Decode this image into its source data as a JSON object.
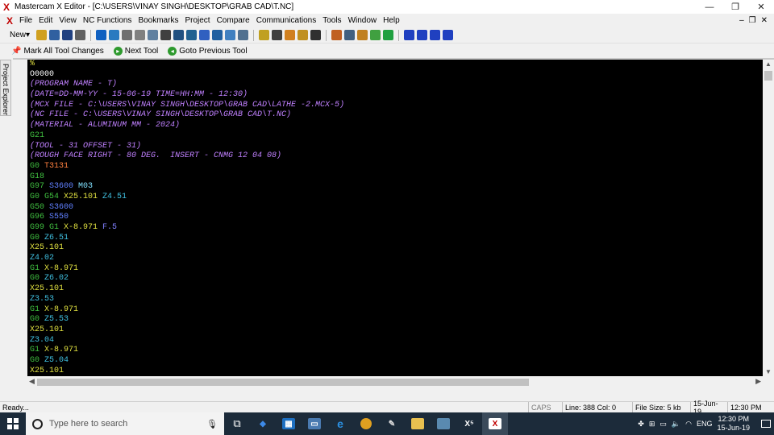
{
  "window": {
    "title": "Mastercam X Editor - [C:\\USERS\\VINAY SINGH\\DESKTOP\\GRAB CAD\\T.NC]",
    "app_icon": "X",
    "minimize": "—",
    "restore": "❐",
    "close": "✕"
  },
  "menu": {
    "doc_icon": "X",
    "items": [
      "File",
      "Edit",
      "View",
      "NC Functions",
      "Bookmarks",
      "Project",
      "Compare",
      "Communications",
      "Tools",
      "Window",
      "Help"
    ],
    "mdi_minimize": "–",
    "mdi_restore": "❐",
    "mdi_close": "✕"
  },
  "toolbar": {
    "new_label": "New",
    "icon_colors": [
      "#d0a020",
      "#3060a0",
      "#204080",
      "#606060",
      "#1060c0",
      "#2a7ac0",
      "#707070",
      "#808080",
      "#6080a0",
      "#404040",
      "#205080",
      "#206090",
      "#3060c0",
      "#2060a0",
      "#4080c0",
      "#507090",
      "#c0a020",
      "#404040",
      "#d08020",
      "#c09020",
      "#303030",
      "#c06020",
      "#406080",
      "#c08020",
      "#40a040",
      "#20a040",
      "#2040c0",
      "#2040c0",
      "#2040c0",
      "#2040c0"
    ]
  },
  "toolbar2": {
    "mark_all": "Mark All Tool Changes",
    "next_tool": "Next Tool",
    "goto_previous": "Goto Previous Tool"
  },
  "side_panel": {
    "label": "Project Explorer"
  },
  "colors": {
    "comment": "#c080ff",
    "g_code": "#40c040",
    "x_word": "#e0e040",
    "z_word": "#40c0e0",
    "s_word": "#6080ff",
    "t_word": "#ff8040",
    "m_word": "#80e0ff",
    "f_word": "#8080ff",
    "plain": "#ffffff",
    "percent": "#e0e040"
  },
  "editor": {
    "lines": [
      [
        {
          "t": "%",
          "c": "percent"
        }
      ],
      [
        {
          "t": "O0000",
          "c": "plain"
        }
      ],
      [
        {
          "t": "(PROGRAM NAME - T)",
          "c": "comment"
        }
      ],
      [
        {
          "t": "(DATE=DD-MM-YY - 15-06-19 TIME=HH:MM - 12:30)",
          "c": "comment"
        }
      ],
      [
        {
          "t": "(MCX FILE - C:\\USERS\\VINAY SINGH\\DESKTOP\\GRAB CAD\\LATHE -2.MCX-5)",
          "c": "comment"
        }
      ],
      [
        {
          "t": "(NC FILE - C:\\USERS\\VINAY SINGH\\DESKTOP\\GRAB CAD\\T.NC)",
          "c": "comment"
        }
      ],
      [
        {
          "t": "(MATERIAL - ALUMINUM MM - 2024)",
          "c": "comment"
        }
      ],
      [
        {
          "t": "G21",
          "c": "g_code"
        }
      ],
      [
        {
          "t": "(TOOL - 31 OFFSET - 31)",
          "c": "comment"
        }
      ],
      [
        {
          "t": "(ROUGH FACE RIGHT - 80 DEG.  INSERT - CNMG 12 04 08)",
          "c": "comment"
        }
      ],
      [
        {
          "t": "G0 ",
          "c": "g_code"
        },
        {
          "t": "T3131",
          "c": "t_word"
        }
      ],
      [
        {
          "t": "G18",
          "c": "g_code"
        }
      ],
      [
        {
          "t": "G97 ",
          "c": "g_code"
        },
        {
          "t": "S3600 ",
          "c": "s_word"
        },
        {
          "t": "M03",
          "c": "m_word"
        }
      ],
      [
        {
          "t": "G0 G54 ",
          "c": "g_code"
        },
        {
          "t": "X25.101 ",
          "c": "x_word"
        },
        {
          "t": "Z4.51",
          "c": "z_word"
        }
      ],
      [
        {
          "t": "G50 ",
          "c": "g_code"
        },
        {
          "t": "S3600",
          "c": "s_word"
        }
      ],
      [
        {
          "t": "G96 ",
          "c": "g_code"
        },
        {
          "t": "S550",
          "c": "s_word"
        }
      ],
      [
        {
          "t": "G99 G1 ",
          "c": "g_code"
        },
        {
          "t": "X-8.971 ",
          "c": "x_word"
        },
        {
          "t": "F.5",
          "c": "f_word"
        }
      ],
      [
        {
          "t": "G0 ",
          "c": "g_code"
        },
        {
          "t": "Z6.51",
          "c": "z_word"
        }
      ],
      [
        {
          "t": "X25.101",
          "c": "x_word"
        }
      ],
      [
        {
          "t": "Z4.02",
          "c": "z_word"
        }
      ],
      [
        {
          "t": "G1 ",
          "c": "g_code"
        },
        {
          "t": "X-8.971",
          "c": "x_word"
        }
      ],
      [
        {
          "t": "G0 ",
          "c": "g_code"
        },
        {
          "t": "Z6.02",
          "c": "z_word"
        }
      ],
      [
        {
          "t": "X25.101",
          "c": "x_word"
        }
      ],
      [
        {
          "t": "Z3.53",
          "c": "z_word"
        }
      ],
      [
        {
          "t": "G1 ",
          "c": "g_code"
        },
        {
          "t": "X-8.971",
          "c": "x_word"
        }
      ],
      [
        {
          "t": "G0 ",
          "c": "g_code"
        },
        {
          "t": "Z5.53",
          "c": "z_word"
        }
      ],
      [
        {
          "t": "X25.101",
          "c": "x_word"
        }
      ],
      [
        {
          "t": "Z3.04",
          "c": "z_word"
        }
      ],
      [
        {
          "t": "G1 ",
          "c": "g_code"
        },
        {
          "t": "X-8.971",
          "c": "x_word"
        }
      ],
      [
        {
          "t": "G0 ",
          "c": "g_code"
        },
        {
          "t": "Z5.04",
          "c": "z_word"
        }
      ],
      [
        {
          "t": "X25.101",
          "c": "x_word"
        }
      ]
    ]
  },
  "status": {
    "ready": "Ready...",
    "caps": "CAPS",
    "line_col": "Line:  388  Col:  0",
    "file_size": "File Size: 5 kb",
    "date": "15-Jun-19",
    "time": "12:30 PM"
  },
  "taskbar": {
    "search_placeholder": "Type here to search",
    "language": "ENG",
    "clock_time": "12:30 PM",
    "clock_date": "15-Jun-19"
  }
}
